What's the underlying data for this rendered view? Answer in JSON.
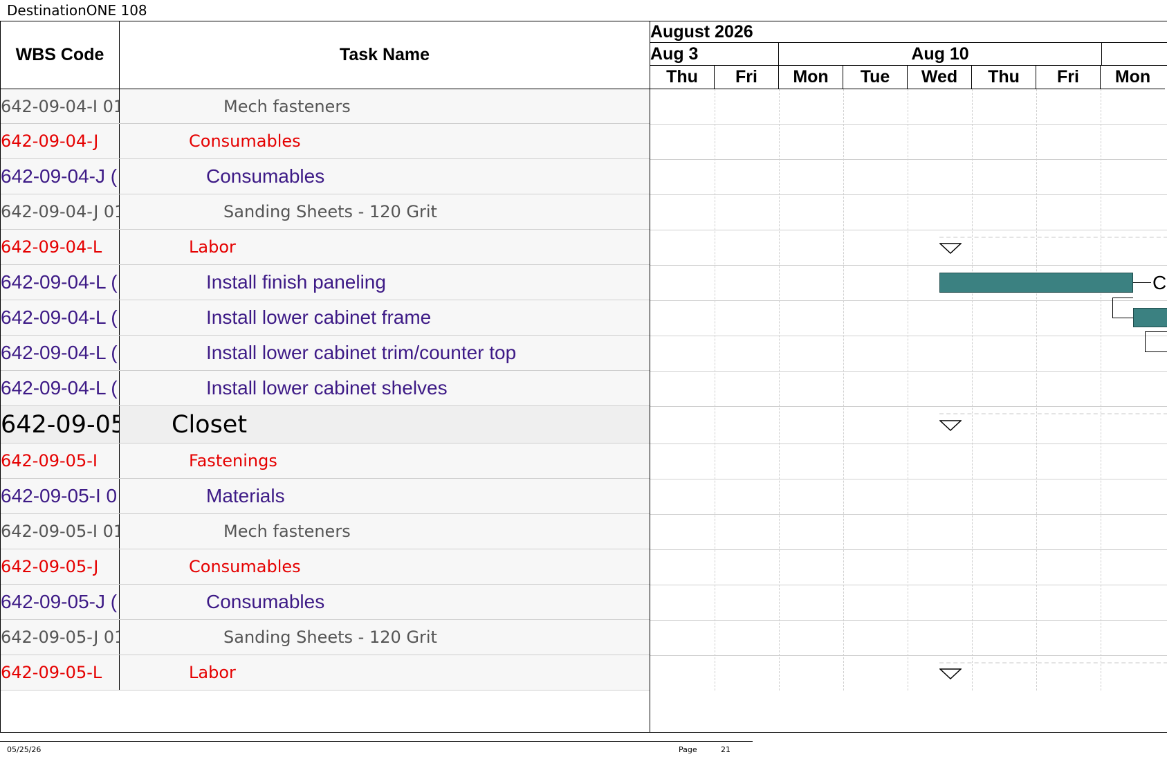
{
  "app_title": "DestinationONE 108",
  "table": {
    "headers": {
      "wbs": "WBS Code",
      "task": "Task Name"
    },
    "rows": [
      {
        "wbs": "642-09-04-I 01",
        "name": "Mech fasteners",
        "level": "grey"
      },
      {
        "wbs": "642-09-04-J",
        "name": "Consumables",
        "level": "red"
      },
      {
        "wbs": "642-09-04-J (",
        "name": "Consumables",
        "level": "purple"
      },
      {
        "wbs": "642-09-04-J 01",
        "name": "Sanding Sheets - 120 Grit",
        "level": "grey"
      },
      {
        "wbs": "642-09-04-L",
        "name": "Labor",
        "level": "red"
      },
      {
        "wbs": "642-09-04-L (",
        "name": "Install finish paneling",
        "level": "purple"
      },
      {
        "wbs": "642-09-04-L (",
        "name": "Install lower cabinet frame",
        "level": "purple"
      },
      {
        "wbs": "642-09-04-L (",
        "name": "Install lower cabinet trim/counter top",
        "level": "purple"
      },
      {
        "wbs": "642-09-04-L (",
        "name": "Install lower cabinet shelves",
        "level": "purple"
      },
      {
        "wbs": "642-09-05",
        "name": "Closet",
        "level": "black"
      },
      {
        "wbs": "642-09-05-I",
        "name": "Fastenings",
        "level": "red"
      },
      {
        "wbs": "642-09-05-I 0",
        "name": "Materials",
        "level": "purple"
      },
      {
        "wbs": "642-09-05-I 01",
        "name": "Mech fasteners",
        "level": "grey"
      },
      {
        "wbs": "642-09-05-J",
        "name": "Consumables",
        "level": "red"
      },
      {
        "wbs": "642-09-05-J (",
        "name": "Consumables",
        "level": "purple"
      },
      {
        "wbs": "642-09-05-J 01",
        "name": "Sanding Sheets - 120 Grit",
        "level": "grey"
      },
      {
        "wbs": "642-09-05-L",
        "name": "Labor",
        "level": "red"
      }
    ]
  },
  "gantt": {
    "month": "August 2026",
    "weeks": [
      "Aug 3",
      "Aug 10"
    ],
    "days": [
      "Thu",
      "Fri",
      "Mon",
      "Tue",
      "Wed",
      "Thu",
      "Fri",
      "Mon"
    ],
    "bar_label": "C"
  },
  "footer": {
    "date": "05/25/26",
    "page_label": "Page",
    "page_number": "21"
  },
  "colors": {
    "bar": "#3b8181",
    "red": "#e50000",
    "purple": "#3d1a86",
    "grey": "#555555"
  }
}
